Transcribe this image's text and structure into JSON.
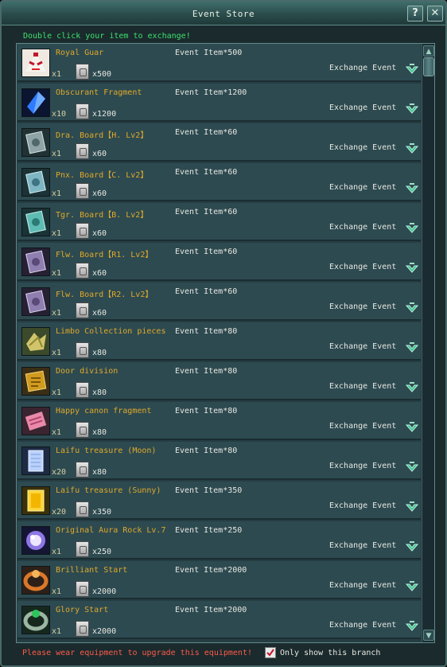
{
  "window": {
    "title": "Event Store",
    "help_label": "?",
    "close_label": "✕"
  },
  "hint": "Double click your item to exchange!",
  "items": [
    {
      "name": "Royal Guar",
      "cost": "Event Item*500",
      "count": "x1",
      "token_count": "x500",
      "exchange": "Exchange Event",
      "icon": "royal-guard-mask-icon"
    },
    {
      "name": "Obscurant Fragment",
      "cost": "Event Item*1200",
      "count": "x10",
      "token_count": "x1200",
      "exchange": "Exchange Event",
      "icon": "blue-crystal-icon"
    },
    {
      "name": "Dra. Board【H. Lv2】",
      "cost": "Event Item*60",
      "count": "x1",
      "token_count": "x60",
      "exchange": "Exchange Event",
      "icon": "dragon-board-icon"
    },
    {
      "name": "Pnx. Board【C. Lv2】",
      "cost": "Event Item*60",
      "count": "x1",
      "token_count": "x60",
      "exchange": "Exchange Event",
      "icon": "phoenix-board-icon"
    },
    {
      "name": "Tgr. Board【B. Lv2】",
      "cost": "Event Item*60",
      "count": "x1",
      "token_count": "x60",
      "exchange": "Exchange Event",
      "icon": "tiger-board-icon"
    },
    {
      "name": "Flw. Board【R1. Lv2】",
      "cost": "Event Item*60",
      "count": "x1",
      "token_count": "x60",
      "exchange": "Exchange Event",
      "icon": "flower-board-icon"
    },
    {
      "name": "Flw. Board【R2. Lv2】",
      "cost": "Event Item*60",
      "count": "x1",
      "token_count": "x60",
      "exchange": "Exchange Event",
      "icon": "flower-board-icon"
    },
    {
      "name": "Limbo Collection pieces",
      "cost": "Event Item*80",
      "count": "x1",
      "token_count": "x80",
      "exchange": "Exchange Event",
      "icon": "limbo-pieces-icon"
    },
    {
      "name": "Door division",
      "cost": "Event Item*80",
      "count": "x1",
      "token_count": "x80",
      "exchange": "Exchange Event",
      "icon": "door-division-icon"
    },
    {
      "name": "Happy canon fragment",
      "cost": "Event Item*80",
      "count": "x1",
      "token_count": "x80",
      "exchange": "Exchange Event",
      "icon": "canon-fragment-icon"
    },
    {
      "name": "Laifu treasure (Moon)",
      "cost": "Event Item*80",
      "count": "x20",
      "token_count": "x80",
      "exchange": "Exchange Event",
      "icon": "moon-treasure-icon"
    },
    {
      "name": "Laifu treasure (Sunny)",
      "cost": "Event Item*350",
      "count": "x20",
      "token_count": "x350",
      "exchange": "Exchange Event",
      "icon": "sun-treasure-icon"
    },
    {
      "name": "Original Aura Rock Lv.7",
      "cost": "Event Item*250",
      "count": "x1",
      "token_count": "x250",
      "exchange": "Exchange Event",
      "icon": "aura-rock-icon"
    },
    {
      "name": "Brilliant Start",
      "cost": "Event Item*2000",
      "count": "x1",
      "token_count": "x2000",
      "exchange": "Exchange Event",
      "icon": "brilliant-ring-icon"
    },
    {
      "name": "Glory Start",
      "cost": "Event Item*2000",
      "count": "x1",
      "token_count": "x2000",
      "exchange": "Exchange Event",
      "icon": "glory-ring-icon"
    }
  ],
  "scrollbar": {
    "up": "▲",
    "down": "▼"
  },
  "footer": {
    "warning": "Please wear equipment to upgrade this equipment!",
    "branch_label": "Only show this branch",
    "branch_checked": true
  },
  "colors": {
    "item_name": "#e0a928",
    "hint": "#3fe06c",
    "warning": "#ff5a48",
    "row_background": "#2d4a51"
  }
}
